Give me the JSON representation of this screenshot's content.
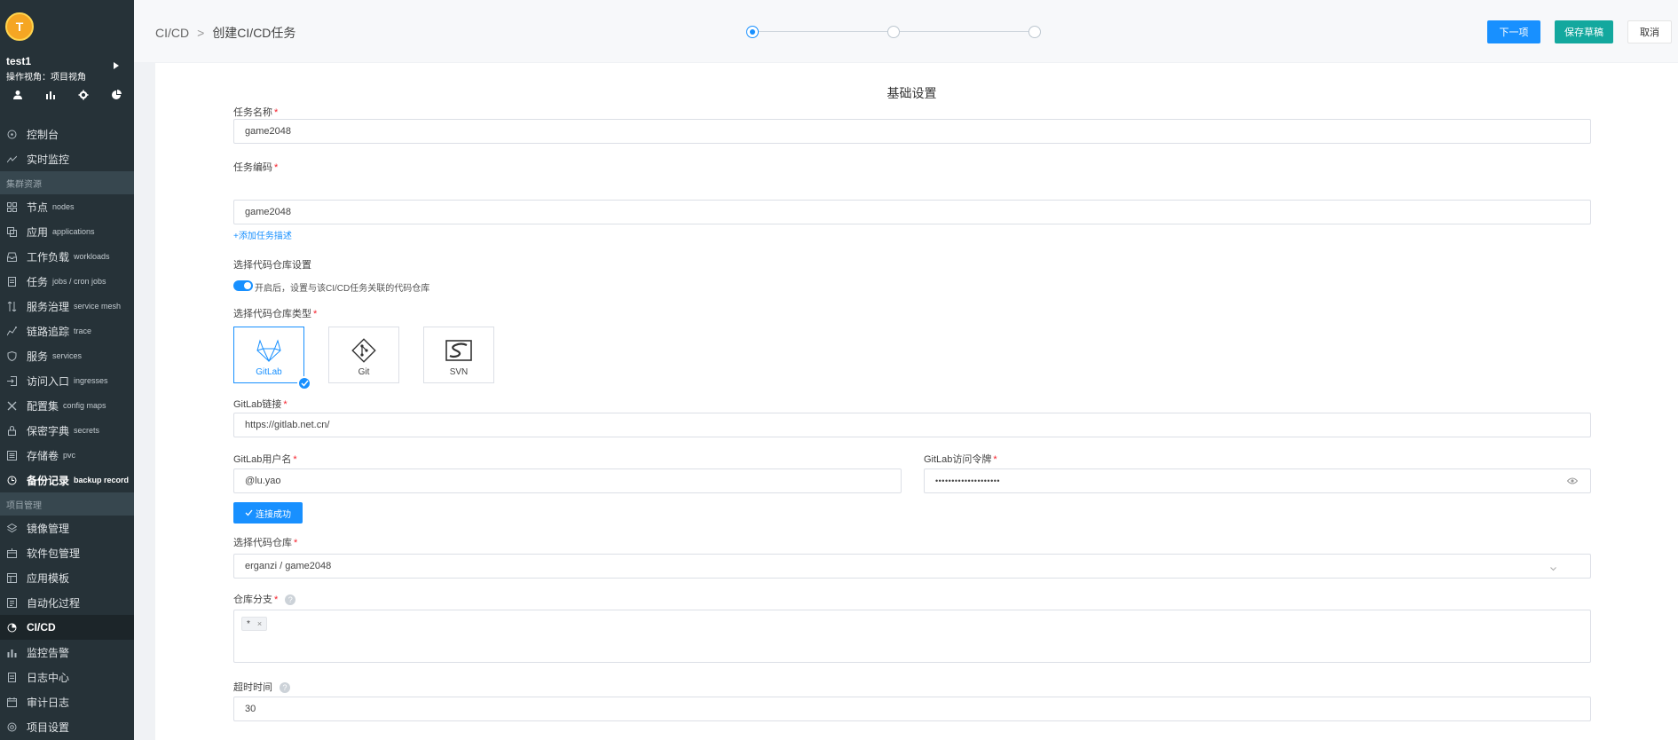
{
  "user": {
    "avatar_letter": "T",
    "name": "test1",
    "view_label": "操作视角：项目视角"
  },
  "quick_icons": [
    "user-icon",
    "bar-chart-icon",
    "gear-icon",
    "pie-chart-icon"
  ],
  "sidebar": {
    "top_items": [
      {
        "label": "控制台",
        "en": "",
        "icon": "dashboard-icon"
      },
      {
        "label": "实时监控",
        "en": "",
        "icon": "trend-icon"
      }
    ],
    "cluster_group": "集群资源",
    "cluster_items": [
      {
        "label": "节点",
        "en": "nodes",
        "icon": "grid-icon"
      },
      {
        "label": "应用",
        "en": "applications",
        "icon": "copy-icon"
      },
      {
        "label": "工作负载",
        "en": "workloads",
        "icon": "inbox-icon"
      },
      {
        "label": "任务",
        "en": "jobs / cron jobs",
        "icon": "file-icon"
      },
      {
        "label": "服务治理",
        "en": "service mesh",
        "icon": "swap-icon"
      },
      {
        "label": "链路追踪",
        "en": "trace",
        "icon": "trace-icon"
      },
      {
        "label": "服务",
        "en": "services",
        "icon": "shield-icon"
      },
      {
        "label": "访问入口",
        "en": "ingresses",
        "icon": "login-icon"
      },
      {
        "label": "配置集",
        "en": "config maps",
        "icon": "tools-icon"
      },
      {
        "label": "保密字典",
        "en": "secrets",
        "icon": "lock-icon"
      },
      {
        "label": "存储卷",
        "en": "pvc",
        "icon": "database-icon"
      },
      {
        "label": "备份记录",
        "en": "backup record",
        "icon": "clock-icon"
      }
    ],
    "project_group": "项目管理",
    "project_items": [
      {
        "label": "镜像管理",
        "icon": "layers-icon"
      },
      {
        "label": "软件包管理",
        "icon": "package-icon"
      },
      {
        "label": "应用模板",
        "icon": "template-icon"
      },
      {
        "label": "自动化过程",
        "icon": "automation-icon"
      },
      {
        "label": "CI/CD",
        "icon": "cicd-icon"
      },
      {
        "label": "监控告警",
        "icon": "bar-chart-icon"
      },
      {
        "label": "日志中心",
        "icon": "log-icon"
      },
      {
        "label": "审计日志",
        "icon": "calendar-icon"
      },
      {
        "label": "项目设置",
        "icon": "settings-icon"
      }
    ]
  },
  "header": {
    "breadcrumb_root": "CI/CD",
    "breadcrumb_sep": ">",
    "breadcrumb_current": "创建CI/CD任务",
    "next_button": "下一项",
    "draft_button": "保存草稿",
    "cancel_button": "取消"
  },
  "steps": {
    "total": 3,
    "current": 1
  },
  "form": {
    "section_title": "基础设置",
    "task_name_label": "任务名称",
    "task_name_value": "game2048",
    "task_code_label": "任务编码",
    "task_code_value": "game2048",
    "add_description_link": "+添加任务描述",
    "repo_setting_label": "选择代码仓库设置",
    "repo_toggle_text": "开启后，设置与该CI/CD任务关联的代码仓库",
    "repo_type_label": "选择代码仓库类型",
    "repo_types": [
      "GitLab",
      "Git",
      "SVN"
    ],
    "gitlab_url_label": "GitLab链接",
    "gitlab_url_value": "https://gitlab.net.cn/",
    "gitlab_user_label": "GitLab用户名",
    "gitlab_user_value": "@lu.yao",
    "gitlab_token_label": "GitLab访问令牌",
    "gitlab_token_value": "••••••••••••••••••••",
    "connect_button": "连接成功",
    "repo_select_label": "选择代码仓库",
    "repo_select_value": "erganzi / game2048",
    "branch_label": "仓库分支",
    "branch_tag": "*",
    "timeout_label": "超时时间",
    "timeout_value": "30"
  },
  "colors": {
    "primary": "#1890ff",
    "teal": "#13a89e",
    "sidebar_bg": "#263238",
    "avatar": "#f5a623"
  }
}
